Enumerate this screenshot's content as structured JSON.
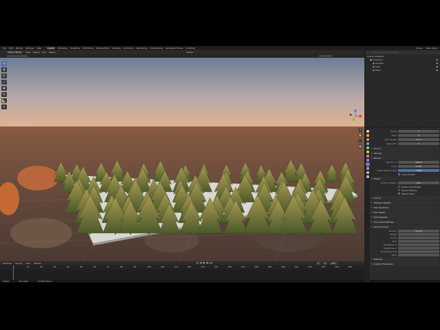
{
  "menu": [
    "File",
    "Edit",
    "Render",
    "Window",
    "Help"
  ],
  "workspace_tabs": [
    {
      "label": "Layout",
      "active": true
    },
    {
      "label": "Modeling",
      "active": false
    },
    {
      "label": "Sculpting",
      "active": false
    },
    {
      "label": "UV Editing",
      "active": false
    },
    {
      "label": "Texture Paint",
      "active": false
    },
    {
      "label": "Shading",
      "active": false
    },
    {
      "label": "Animation",
      "active": false
    },
    {
      "label": "Rendering",
      "active": false
    },
    {
      "label": "Compositing",
      "active": false
    },
    {
      "label": "Geometry Nodes",
      "active": false
    },
    {
      "label": "Scripting",
      "active": false
    }
  ],
  "topbar_right": {
    "scene": "Scene",
    "view_layer": "View Layer"
  },
  "viewport_header": {
    "mode": "Object Mode",
    "view": "View",
    "select": "Select",
    "add": "Add",
    "object": "Object",
    "orientation": "Global"
  },
  "viewport_info": {
    "line1": "User Perspective",
    "line2": "(1) Collection | Plane"
  },
  "tools": [
    "cursor",
    "move",
    "rotate",
    "scale",
    "transform",
    "annotate",
    "measure",
    "add"
  ],
  "nav_buttons": [
    "+",
    "✋",
    "🎥",
    "▦"
  ],
  "outliner": {
    "title": "Scene Collection",
    "rows": [
      {
        "label": "Collection",
        "indent": 1,
        "color": "#d8d8d8"
      },
      {
        "label": "Camera",
        "indent": 2,
        "color": "#e5a35a"
      },
      {
        "label": "Light",
        "indent": 2,
        "color": "#e5a35a"
      },
      {
        "label": "Plane",
        "indent": 2,
        "color": "#e5a35a"
      }
    ]
  },
  "properties": {
    "fields": [
      {
        "label": "Frame",
        "value": "1"
      },
      {
        "label": "Seed",
        "value": "0"
      },
      {
        "label": "Hair Length",
        "value": "0.2 m"
      },
      {
        "label": "Segments",
        "value": "5"
      }
    ],
    "sections_a": [
      "Source",
      "Velocity",
      "Render"
    ],
    "render_fields": [
      {
        "label": "Render As",
        "value": "Object",
        "blue": false
      },
      {
        "label": "Scale",
        "value": "0.200",
        "blue": false
      },
      {
        "label": "Scale Randomness",
        "value": "0.800",
        "blue": true
      }
    ],
    "show_emitter": "Show Emitter",
    "object_fields": [
      {
        "label": "Instance Object",
        "value": "Tree"
      }
    ],
    "object_checks": [
      "Global Coordinates",
      "Object Rotation",
      "Object Scale"
    ],
    "sections_b": [
      "Timing",
      "Viewport Display",
      "Hair Dynamics",
      "Hair Shape",
      "Field Weights",
      "Force Field Settings",
      "Vertex Groups"
    ],
    "vertex_group_rows": [
      "Density",
      "Length",
      "Clump",
      "Kink",
      "Roughness 1",
      "Roughness 2",
      "Roughness End",
      "Twist"
    ],
    "vertex_density_value": "Group",
    "sections_c": [
      "Textures",
      "Custom Properties"
    ]
  },
  "timeline": {
    "menus": [
      "Playback",
      "Keying",
      "View",
      "Marker"
    ],
    "start": "1",
    "end": "250",
    "current": "1",
    "ticks": [
      "0",
      "10",
      "20",
      "30",
      "40",
      "50",
      "60",
      "70",
      "80",
      "90",
      "100",
      "110",
      "120",
      "130",
      "140",
      "150",
      "160",
      "170",
      "180",
      "190",
      "200",
      "210",
      "220",
      "230",
      "240",
      "250"
    ]
  },
  "status": [
    "Select",
    "Pan View",
    "Context Menu"
  ],
  "colors": {
    "accent": "#4772b3",
    "sky_top": "#6f7f97",
    "sky_bottom": "#e7b38a",
    "tree": "#7b7a3a",
    "plane": "#d6d6d2",
    "ground": "#5b4538"
  }
}
